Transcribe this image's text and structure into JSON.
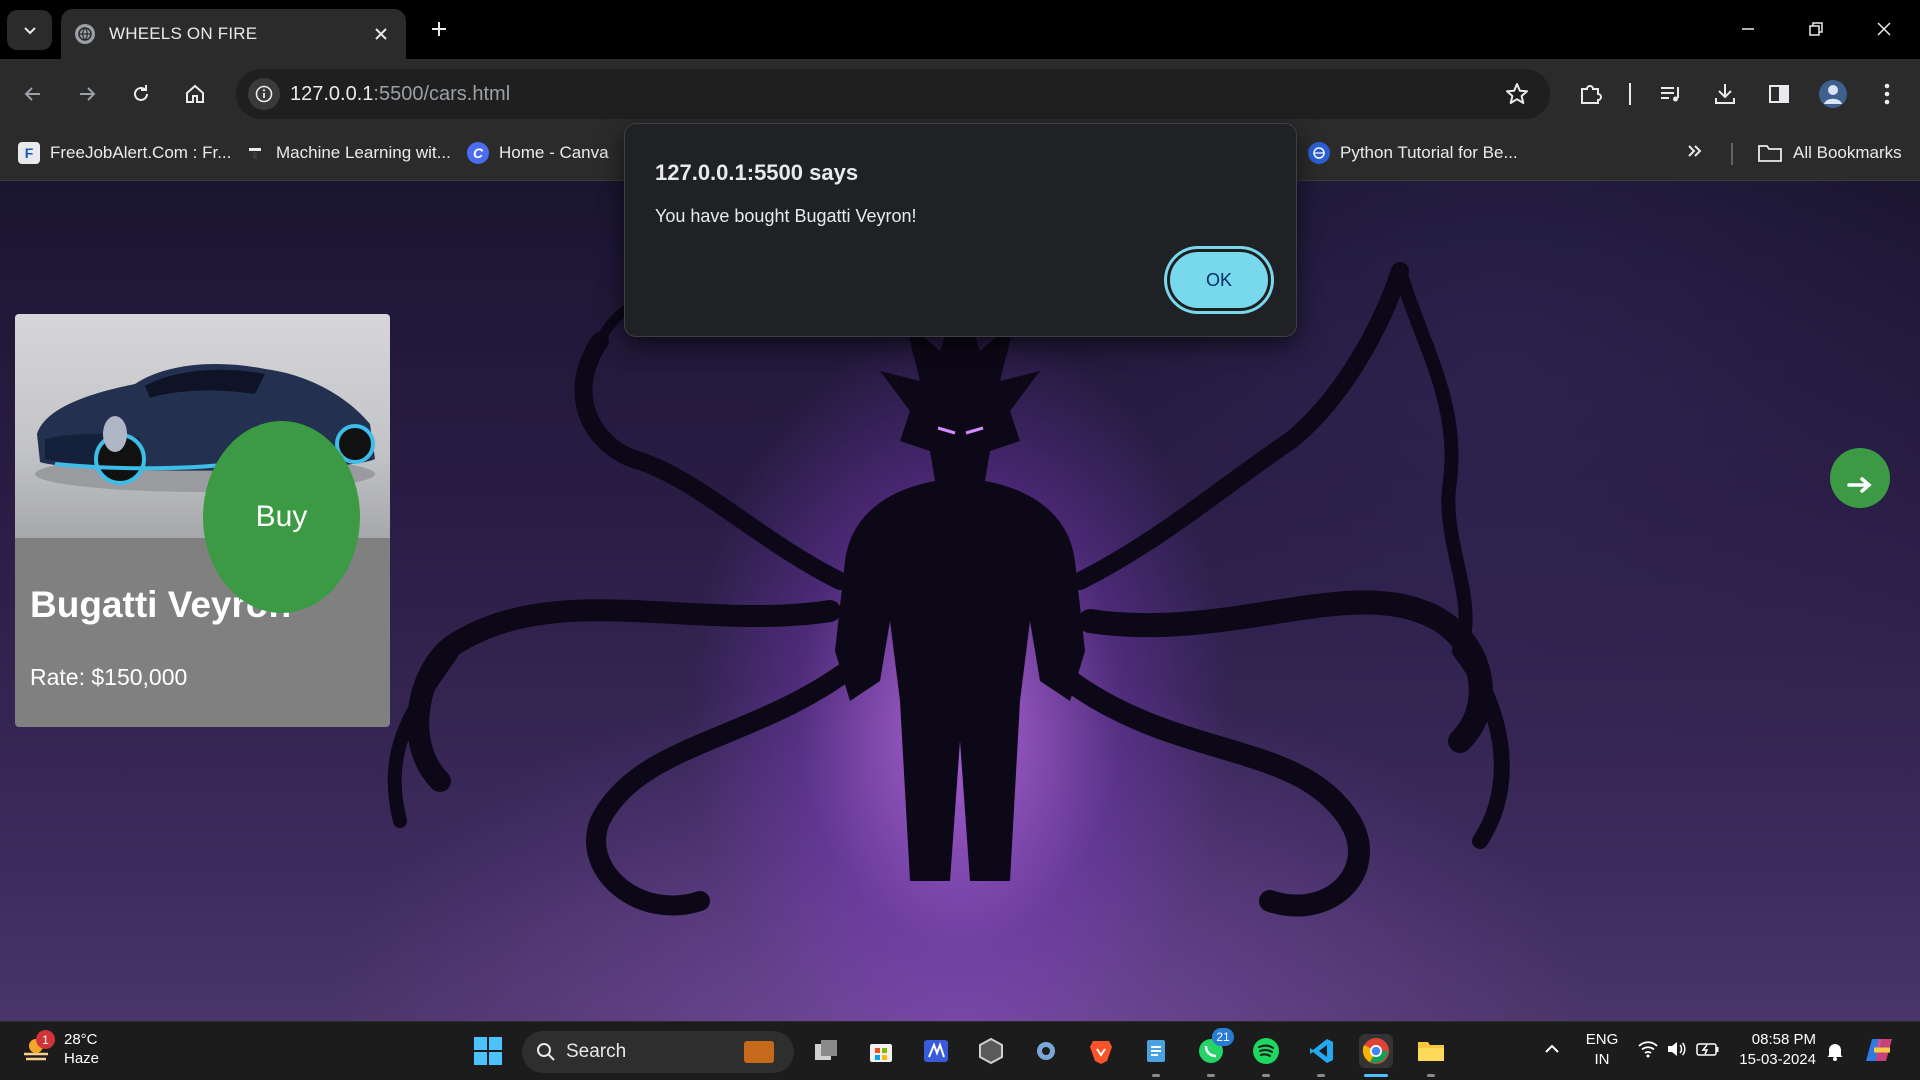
{
  "browser": {
    "tab_title": "WHEELS ON FIRE",
    "url_host": "127.0.0.1",
    "url_path": ":5500/cars.html",
    "bookmarks": [
      {
        "label": "FreeJobAlert.Com : Fr...",
        "icon": "freejobalert-icon"
      },
      {
        "label": "Machine Learning wit...",
        "icon": "ml-icon"
      },
      {
        "label": "Home - Canva",
        "icon": "canva-icon"
      },
      {
        "label": "Python Tutorial for Be...",
        "icon": "python-icon"
      }
    ],
    "all_bookmarks_label": "All Bookmarks"
  },
  "dialog": {
    "title": "127.0.0.1:5500 says",
    "message": "You have bought Bugatti Veyron!",
    "ok_label": "OK"
  },
  "card": {
    "car_name": "Bugatti Veyron",
    "rate": "Rate: $150,000",
    "buy_label": "Buy"
  },
  "taskbar": {
    "weather_temp": "28°C",
    "weather_desc": "Haze",
    "weather_badge": "1",
    "search_label": "Search",
    "whatsapp_badge": "21",
    "lang_line1": "ENG",
    "lang_line2": "IN",
    "time": "08:58 PM",
    "date": "15-03-2024"
  },
  "colors": {
    "buy_button": "#3c9a44",
    "ok_button": "#78d9ec",
    "dialog_bg": "#202124",
    "card_bg": "#808080"
  }
}
